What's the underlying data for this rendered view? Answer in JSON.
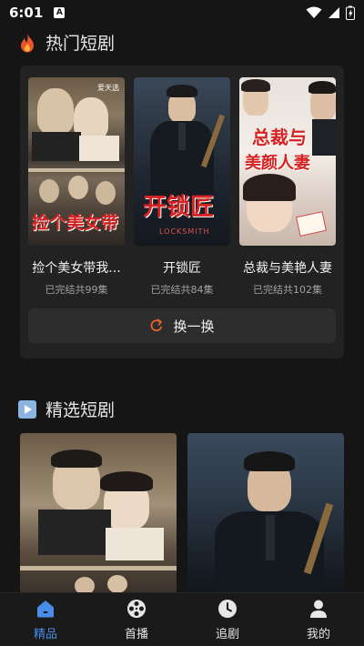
{
  "status_bar": {
    "time": "6:01",
    "notification_glyph": "A"
  },
  "hot_section": {
    "title": "热门短剧",
    "items": [
      {
        "title": "捡个美女带我...",
        "status": "已完结共99集",
        "poster_text": "捡个美女带",
        "poster_badge": "爱天选"
      },
      {
        "title": "开锁匠",
        "status": "已完结共84集",
        "poster_text": "开锁匠",
        "poster_subtext": "LOCKSMITH"
      },
      {
        "title": "总裁与美艳人妻",
        "status": "已完结共102集",
        "poster_text_line1": "总裁与",
        "poster_text_line2": "美颜人妻"
      }
    ],
    "refresh_label": "换一换"
  },
  "featured_section": {
    "title": "精选短剧"
  },
  "bottom_nav": {
    "items": [
      {
        "label": "精品",
        "icon": "home-icon",
        "active": true
      },
      {
        "label": "首播",
        "icon": "film-reel-icon",
        "active": false
      },
      {
        "label": "追剧",
        "icon": "clock-icon",
        "active": false
      },
      {
        "label": "我的",
        "icon": "user-icon",
        "active": false
      }
    ]
  },
  "colors": {
    "accent": "#4a8de8",
    "refresh_icon": "#e8622a",
    "background": "#151515",
    "panel": "#222222"
  }
}
